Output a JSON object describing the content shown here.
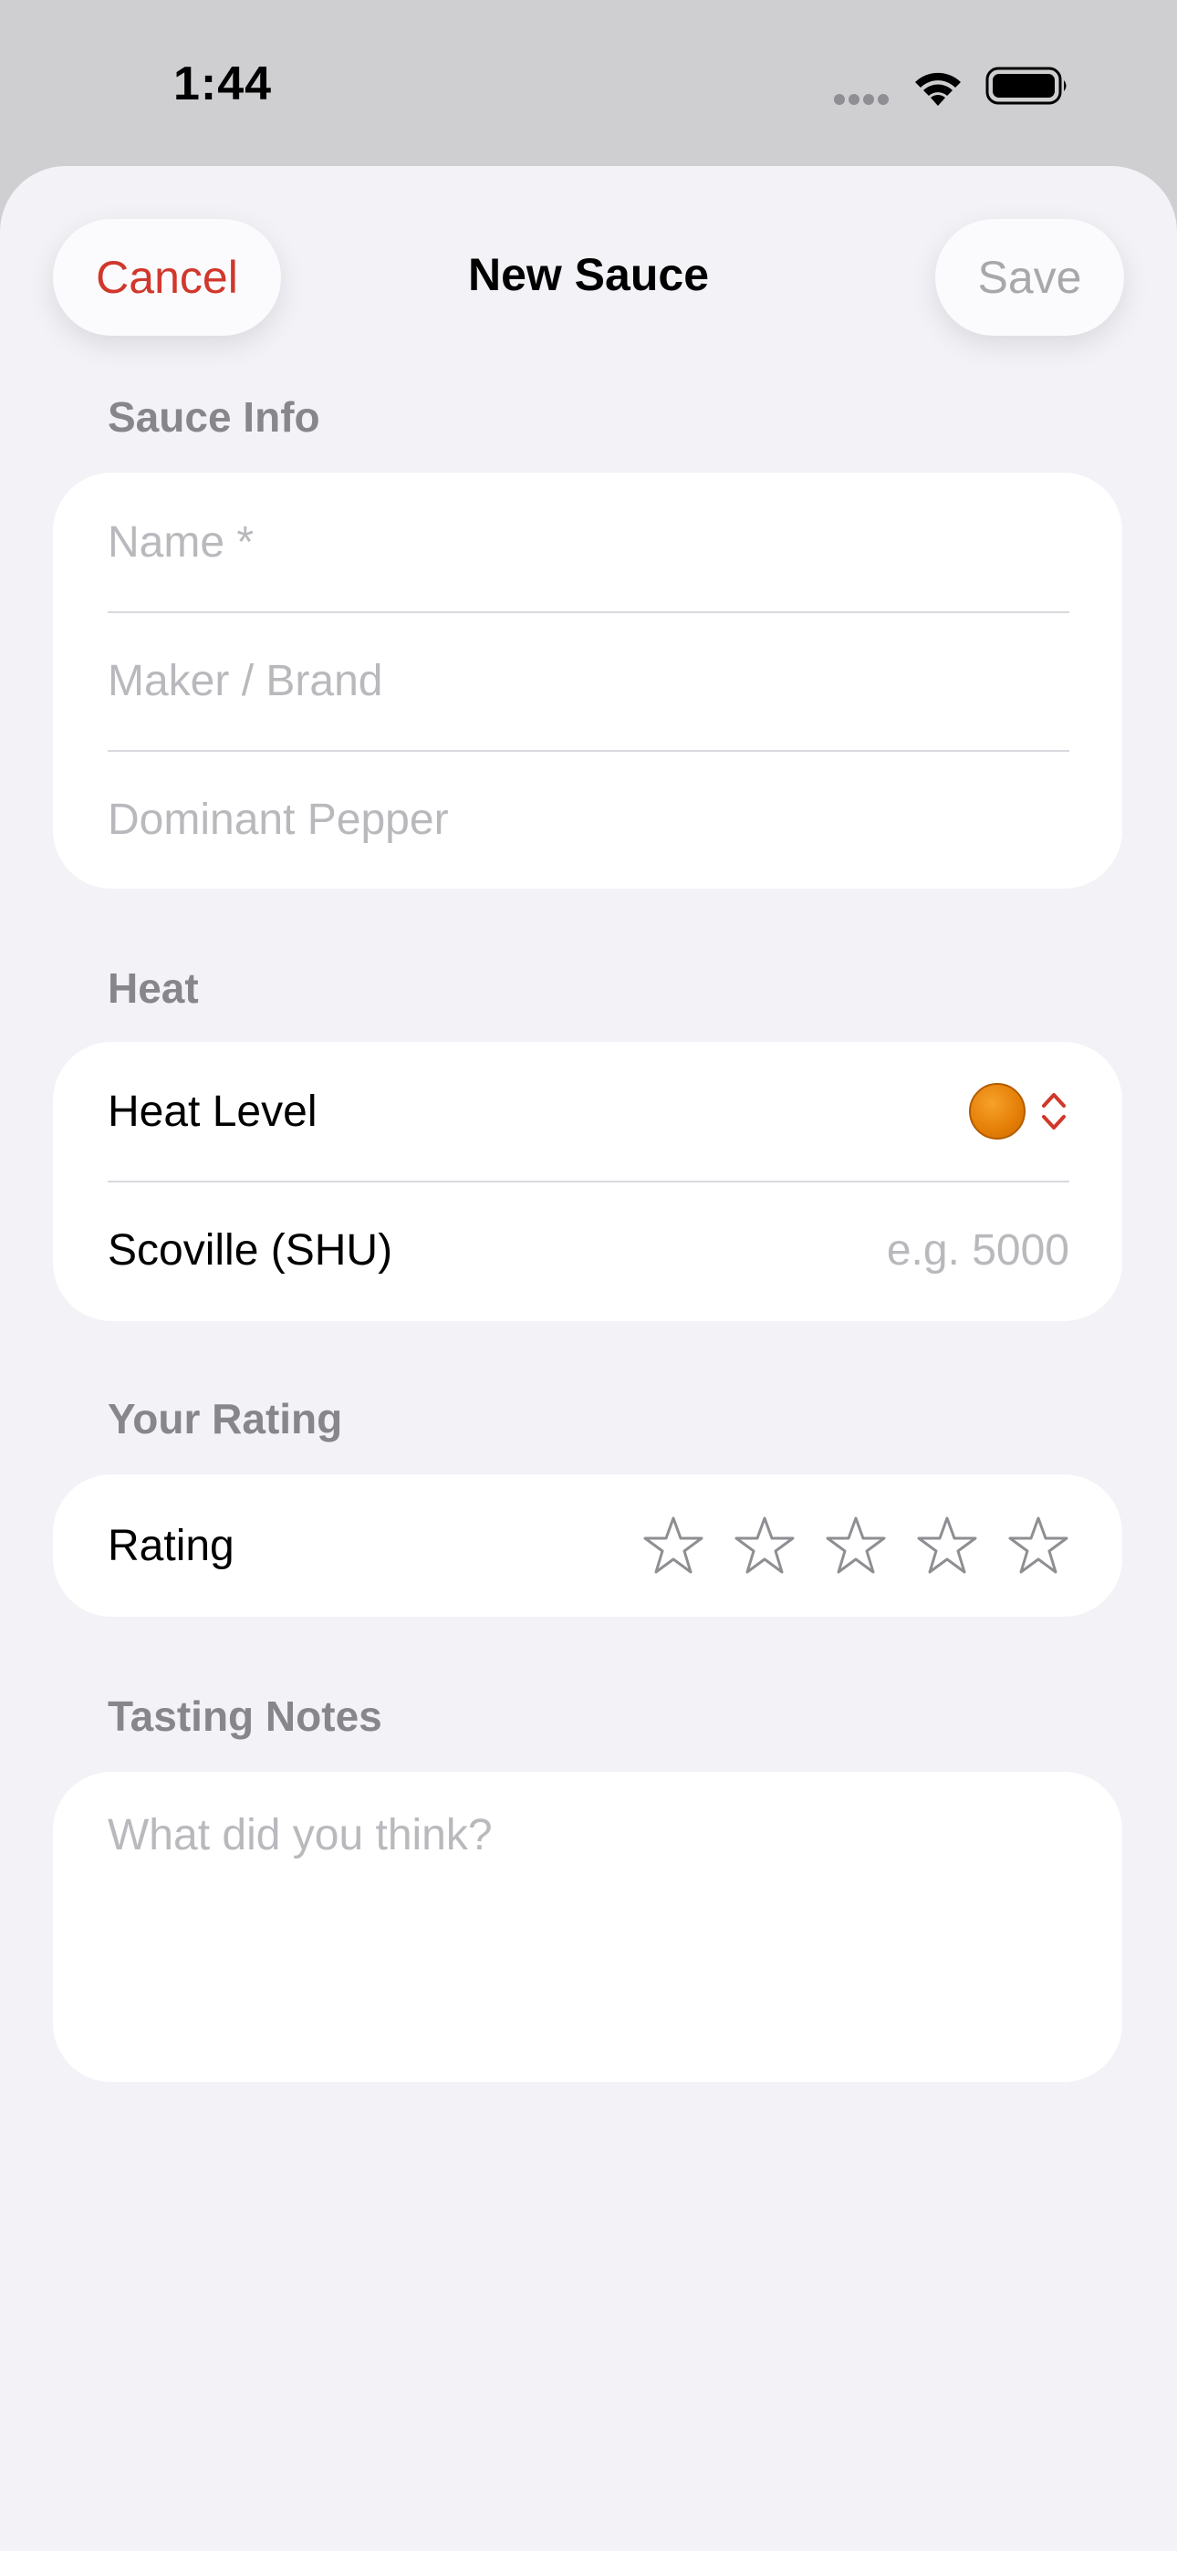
{
  "status": {
    "time": "1:44"
  },
  "nav": {
    "cancel": "Cancel",
    "title": "New Sauce",
    "save": "Save"
  },
  "sauce_info": {
    "header": "Sauce Info",
    "name_placeholder": "Name *",
    "maker_placeholder": "Maker / Brand",
    "pepper_placeholder": "Dominant Pepper"
  },
  "heat": {
    "header": "Heat",
    "level_label": "Heat Level",
    "level_color": "#e47e06",
    "scoville_label": "Scoville (SHU)",
    "scoville_placeholder": "e.g. 5000"
  },
  "rating": {
    "header": "Your Rating",
    "label": "Rating",
    "max_stars": 5,
    "value": 0
  },
  "notes": {
    "header": "Tasting Notes",
    "placeholder": "What did you think?"
  },
  "colors": {
    "accent": "#d0382b",
    "background": "#f2f2f7"
  }
}
